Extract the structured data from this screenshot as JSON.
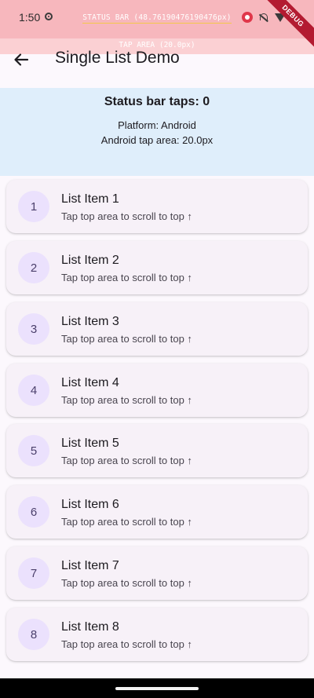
{
  "status_bar": {
    "time": "1:50",
    "overlay_label": "STATUS BAR (48.76190476190476px)",
    "tap_area_label": "TAP AREA (20.0px)",
    "debug_banner": "DEBUG",
    "icons": [
      "record-icon",
      "bell-off-icon",
      "wifi-icon",
      "battery-icon"
    ]
  },
  "app_bar": {
    "title": "Single List Demo",
    "back_icon": "arrow-left-icon"
  },
  "info_panel": {
    "title": "Status bar taps: 0",
    "platform": "Platform: Android",
    "tap_area": "Android tap area: 20.0px"
  },
  "list": {
    "items": [
      {
        "index": "1",
        "title": "List Item 1",
        "subtitle": "Tap top area to scroll to top ↑"
      },
      {
        "index": "2",
        "title": "List Item 2",
        "subtitle": "Tap top area to scroll to top ↑"
      },
      {
        "index": "3",
        "title": "List Item 3",
        "subtitle": "Tap top area to scroll to top ↑"
      },
      {
        "index": "4",
        "title": "List Item 4",
        "subtitle": "Tap top area to scroll to top ↑"
      },
      {
        "index": "5",
        "title": "List Item 5",
        "subtitle": "Tap top area to scroll to top ↑"
      },
      {
        "index": "6",
        "title": "List Item 6",
        "subtitle": "Tap top area to scroll to top ↑"
      },
      {
        "index": "7",
        "title": "List Item 7",
        "subtitle": "Tap top area to scroll to top ↑"
      },
      {
        "index": "8",
        "title": "List Item 8",
        "subtitle": "Tap top area to scroll to top ↑"
      }
    ]
  },
  "colors": {
    "status_overlay": "#f7b7bd",
    "tap_area": "#fbd0d3",
    "info_panel": "#dfeefb",
    "card": "#f7f1f8",
    "avatar": "#ebe1fd",
    "debug_ribbon": "#b31b31"
  }
}
